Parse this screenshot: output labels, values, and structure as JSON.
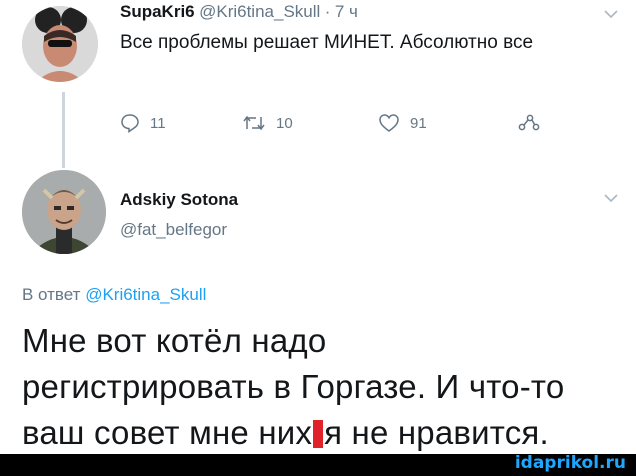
{
  "tweet1": {
    "author_name": "SupaKri6",
    "handle": "@Kri6tina_Skull",
    "separator": "·",
    "time": "7 ч",
    "text": "Все проблемы решает МИНЕТ. Абсолютно все",
    "replies": "11",
    "retweets": "10",
    "likes": "91"
  },
  "tweet2": {
    "author_name": "Adskiy Sotona",
    "handle": "@fat_belfegor",
    "reply_prefix": "В ответ",
    "reply_handle": "@Kri6tina_Skull",
    "text_line1": "Мне вот котёл надо",
    "text_line2": "регистрировать в Горгазе. И что-то",
    "text_line3_before": "ваш совет мне них",
    "text_line3_after": "я не нравится."
  },
  "watermark": "idaprikol.ru",
  "colors": {
    "link": "#1da1f2",
    "secondary_text": "#657786",
    "censor": "#e0232b"
  },
  "icons": [
    "chevron-down-icon",
    "reply-icon",
    "retweet-icon",
    "like-icon",
    "share-icon"
  ]
}
